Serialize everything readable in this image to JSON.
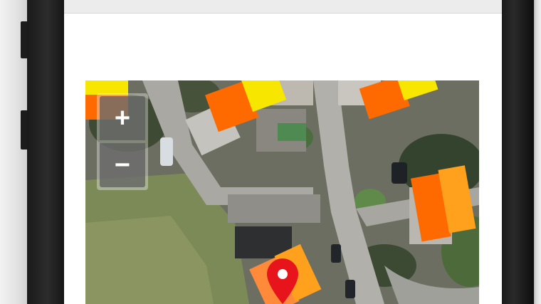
{
  "map": {
    "zoom_in_label": "+",
    "zoom_out_label": "−",
    "marker_icon": "map-pin-icon",
    "roof_colors": [
      "#ff6a00",
      "#f7e600",
      "#ffa11c"
    ],
    "marker_color": "#e8141c"
  }
}
